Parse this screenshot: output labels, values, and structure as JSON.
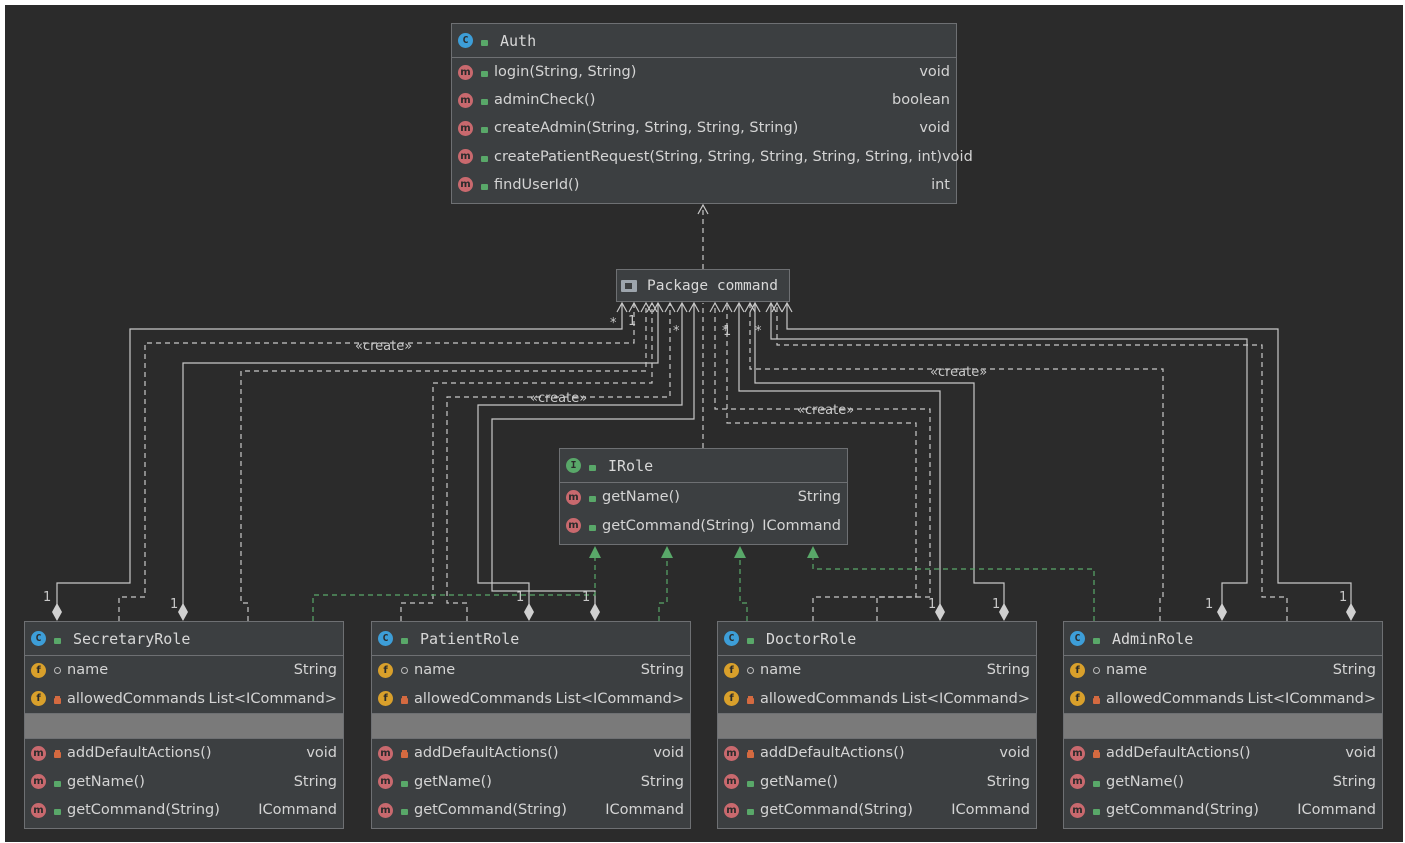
{
  "auth": {
    "name": "Auth",
    "methods": [
      {
        "name": "login(String, String)",
        "type": "void"
      },
      {
        "name": "adminCheck()",
        "type": "boolean"
      },
      {
        "name": "createAdmin(String, String, String, String)",
        "type": "void"
      },
      {
        "name": "createPatientRequest(String, String, String, String, String, int)",
        "type": "void"
      },
      {
        "name": "findUserId()",
        "type": "int"
      }
    ]
  },
  "package": {
    "label": "Package command"
  },
  "irole": {
    "name": "IRole",
    "methods": [
      {
        "name": "getName()",
        "type": "String"
      },
      {
        "name": "getCommand(String)",
        "type": "ICommand"
      }
    ]
  },
  "role_fields": [
    {
      "name": "name",
      "type": "String"
    },
    {
      "name": "allowedCommands",
      "type": "List<ICommand>"
    }
  ],
  "role_methods": [
    {
      "name": "addDefaultActions()",
      "type": "void"
    },
    {
      "name": "getName()",
      "type": "String"
    },
    {
      "name": "getCommand(String)",
      "type": "ICommand"
    }
  ],
  "roles": [
    "SecretaryRole",
    "PatientRole",
    "DoctorRole",
    "AdminRole"
  ],
  "edge_labels": {
    "create": "«create»",
    "one": "1",
    "many": "*"
  },
  "icons": {
    "class": "C",
    "interface": "I",
    "method": "m",
    "field": "f"
  },
  "colors": {
    "background": "#2b2b2b",
    "box": "#3c3f41",
    "border": "#6e7073",
    "realization": "#59a869",
    "edge": "#c8c8c8"
  }
}
